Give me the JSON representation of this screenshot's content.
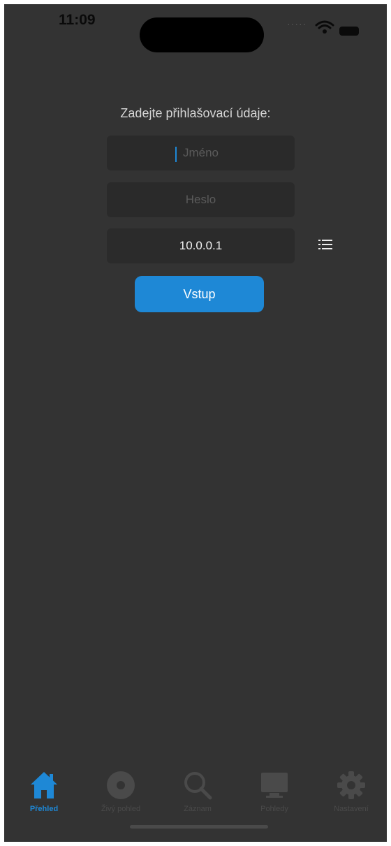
{
  "status_bar": {
    "time": "11:09"
  },
  "login": {
    "prompt": "Zadejte přihlašovací údaje:",
    "username": {
      "value": "",
      "placeholder": "Jméno"
    },
    "password": {
      "value": "",
      "placeholder": "Heslo"
    },
    "server": {
      "value": "10.0.0.1"
    },
    "submit_label": "Vstup"
  },
  "tabbar": {
    "tabs": [
      {
        "label": "Přehled",
        "icon": "home-icon",
        "active": true
      },
      {
        "label": "Živý pohled",
        "icon": "live-view-icon",
        "active": false
      },
      {
        "label": "Záznam",
        "icon": "search-icon",
        "active": false
      },
      {
        "label": "Pohledy",
        "icon": "monitor-icon",
        "active": false
      },
      {
        "label": "Nastavení",
        "icon": "gear-icon",
        "active": false
      }
    ]
  },
  "colors": {
    "accent": "#1e88d6",
    "background": "#333333",
    "field": "#2a2a2a",
    "inactive": "#4a4a4a"
  }
}
